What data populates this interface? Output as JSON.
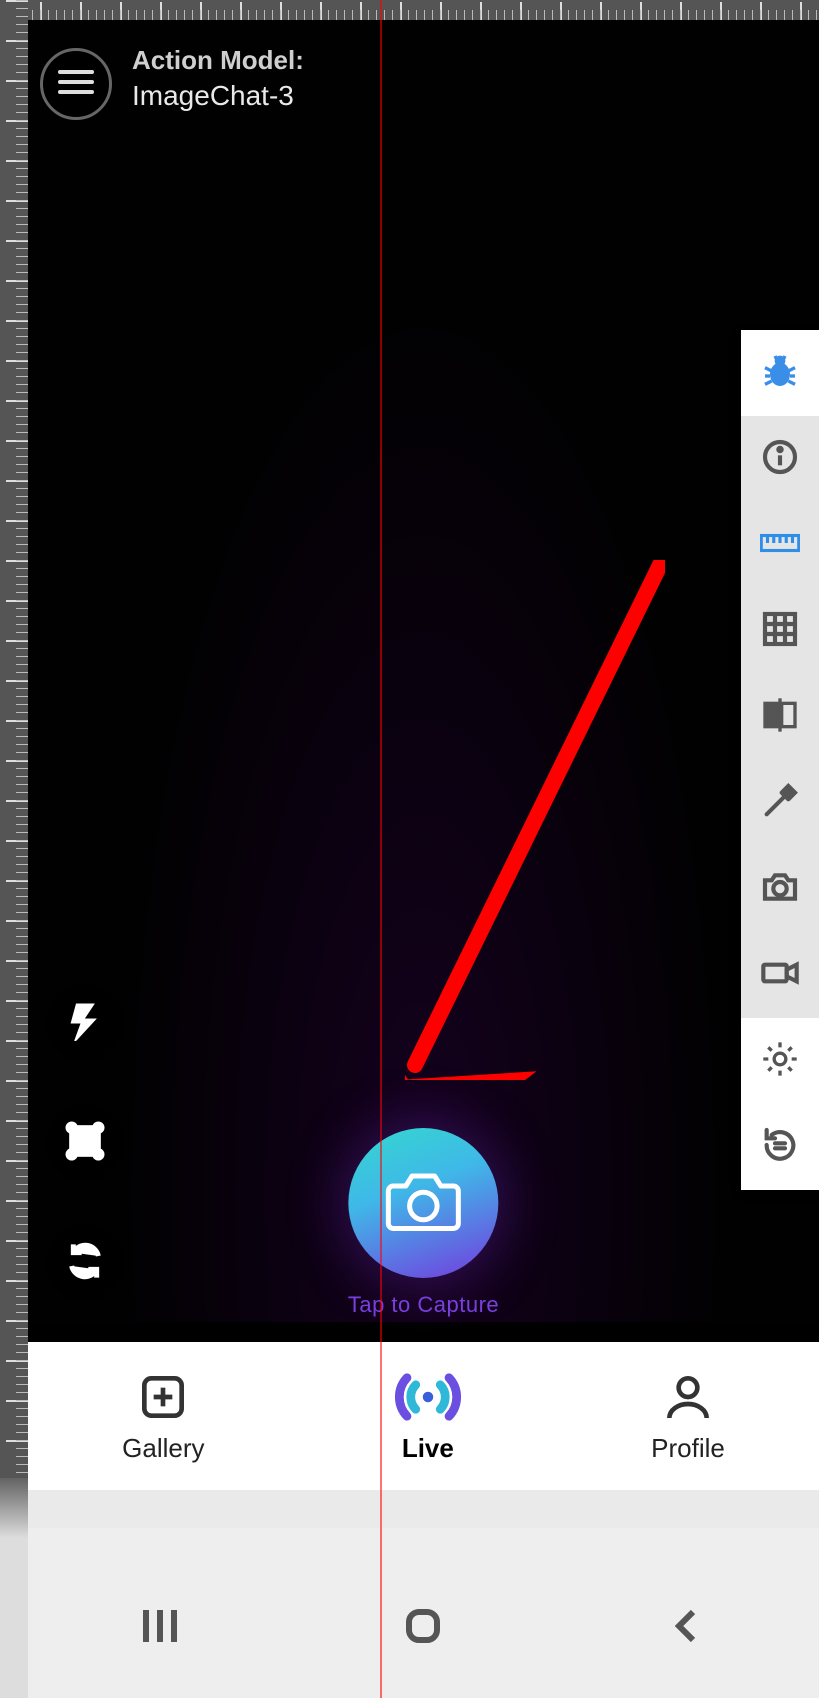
{
  "header": {
    "title_line1": "Action Model:",
    "title_line2": "ImageChat-3"
  },
  "capture": {
    "label": "Tap to Capture"
  },
  "bottom_nav": {
    "gallery": "Gallery",
    "live": "Live",
    "profile": "Profile"
  },
  "icons": {
    "menu": "menu-icon",
    "flash": "flash-icon",
    "crop": "crop-icon",
    "switch_camera": "switch-camera-icon",
    "camera": "camera-icon",
    "bug": "bug-icon",
    "info": "info-icon",
    "ruler": "ruler-icon",
    "grid": "grid-icon",
    "compare": "compare-icon",
    "eyedropper": "eyedropper-icon",
    "photo": "photo-icon",
    "video": "video-icon",
    "settings": "settings-icon",
    "restart": "restart-icon",
    "plus_box": "plus-box-icon",
    "broadcast": "broadcast-icon",
    "person": "person-icon",
    "sys_recents": "recents-icon",
    "sys_home": "home-icon",
    "sys_back": "back-icon"
  },
  "annotation": {
    "arrow_color": "#ff0000"
  }
}
